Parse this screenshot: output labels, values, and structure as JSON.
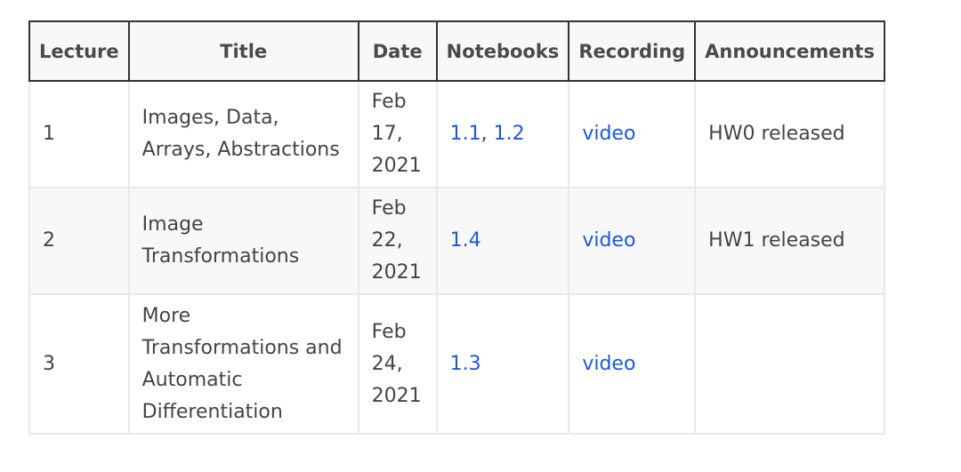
{
  "table": {
    "headers": [
      "Lecture",
      "Title",
      "Date",
      "Notebooks",
      "Recording",
      "Announcements"
    ],
    "rows": [
      {
        "lecture": "1",
        "title_lines": [
          "Images, Data,",
          "Arrays, Abstractions"
        ],
        "date_lines": [
          "Feb",
          "17,",
          "2021"
        ],
        "notebooks": [
          "1.1",
          "1.2"
        ],
        "notebook_separator": ", ",
        "recording": "video",
        "announcement": "HW0 released"
      },
      {
        "lecture": "2",
        "title_lines": [
          "Image",
          "Transformations"
        ],
        "date_lines": [
          "Feb",
          "22,",
          "2021"
        ],
        "notebooks": [
          "1.4"
        ],
        "recording": "video",
        "announcement": "HW1 released"
      },
      {
        "lecture": "3",
        "title_lines": [
          "More",
          "Transformations and",
          "Automatic",
          "Differentiation"
        ],
        "date_lines": [
          "Feb",
          "24,",
          "2021"
        ],
        "notebooks": [
          "1.3"
        ],
        "recording": "video",
        "announcement": ""
      }
    ]
  },
  "colors": {
    "link": "#1b58e0",
    "text": "#444444",
    "header_border": "#333333",
    "cell_border": "#e9e9e9",
    "stripe": "#f8f8f8"
  }
}
